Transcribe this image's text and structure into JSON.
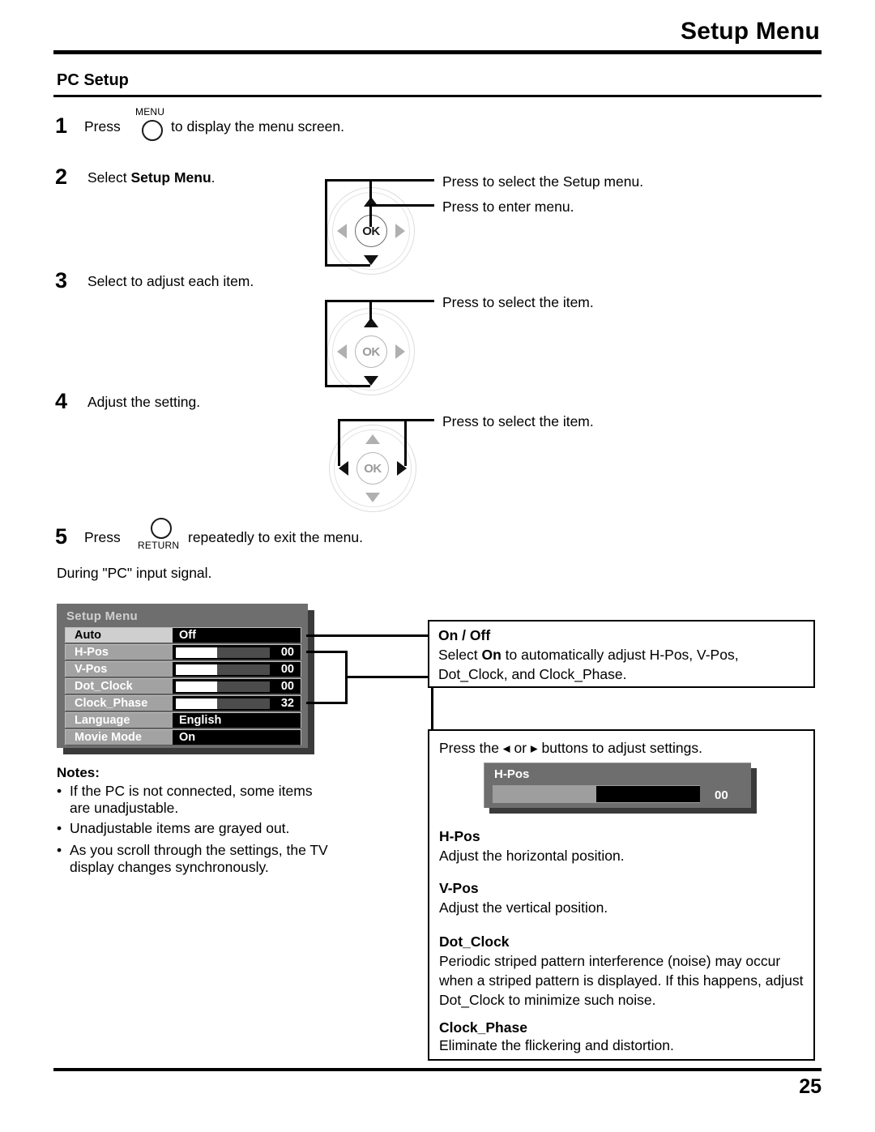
{
  "header": {
    "title": "Setup Menu"
  },
  "section": {
    "title": "PC Setup"
  },
  "steps": [
    {
      "num": "1",
      "pre": "Press",
      "button": "MENU",
      "post": "to display the menu screen."
    },
    {
      "num": "2",
      "pre": "Select ",
      "bold": "Setup Menu",
      "post": "."
    },
    {
      "num": "3",
      "text": "Select to adjust each item."
    },
    {
      "num": "4",
      "text": "Adjust the setting."
    },
    {
      "num": "5",
      "pre": "Press",
      "button": "RETURN",
      "post": "repeatedly to exit the menu."
    }
  ],
  "callouts": {
    "pad1_up": "Press to select the Setup menu.",
    "pad1_ok": "Press to enter menu.",
    "pad2_up": "Press to select the item.",
    "pad3_lr": "Press to select the item."
  },
  "osd_intro": "During \"PC\" input signal.",
  "osd": {
    "title": "Setup Menu",
    "rows": [
      {
        "label": "Auto",
        "type": "text",
        "value": "Off",
        "selected": true
      },
      {
        "label": "H-Pos",
        "type": "bar",
        "value": "00",
        "fill_pct": 44,
        "selected": false
      },
      {
        "label": "V-Pos",
        "type": "bar",
        "value": "00",
        "fill_pct": 44,
        "selected": false
      },
      {
        "label": "Dot_Clock",
        "type": "bar",
        "value": "00",
        "fill_pct": 44,
        "selected": false
      },
      {
        "label": "Clock_Phase",
        "type": "bar",
        "value": "32",
        "fill_pct": 44,
        "selected": false
      },
      {
        "label": "Language",
        "type": "text",
        "value": "English",
        "selected": false
      },
      {
        "label": "Movie Mode",
        "type": "text",
        "value": "On",
        "selected": false
      }
    ]
  },
  "notes": {
    "title": "Notes:",
    "items": [
      "If the PC is not connected, some items are unadjustable.",
      "Unadjustable items are grayed out.",
      "As you scroll through the settings, the TV display changes synchronously."
    ]
  },
  "onoff_box": {
    "head": "On / Off",
    "line1_a": "Select ",
    "line1_b": "On",
    "line1_c": " to automatically adjust H-Pos, V-Pos,",
    "line2": "Dot_Clock, and Clock_Phase."
  },
  "adjust_box": {
    "intro_a": "Press the ",
    "intro_arrow_left": "◂",
    "intro_b": " or ",
    "intro_arrow_right": "▸",
    "intro_c": " buttons to adjust settings.",
    "hpos_osd": {
      "title": "H-Pos",
      "value": "00",
      "fill_pct": 50
    },
    "entries": [
      {
        "head": "H-Pos",
        "lines": [
          "Adjust the horizontal position."
        ]
      },
      {
        "head": "V-Pos",
        "lines": [
          "Adjust the vertical position."
        ]
      },
      {
        "head": "Dot_Clock",
        "lines": [
          "Periodic striped pattern interference (noise) may occur",
          "when a striped pattern is displayed. If this happens, adjust",
          "Dot_Clock to minimize such noise."
        ]
      },
      {
        "head": "Clock_Phase",
        "lines": [
          "Eliminate the flickering and distortion."
        ]
      }
    ]
  },
  "footer": {
    "page": "25"
  }
}
